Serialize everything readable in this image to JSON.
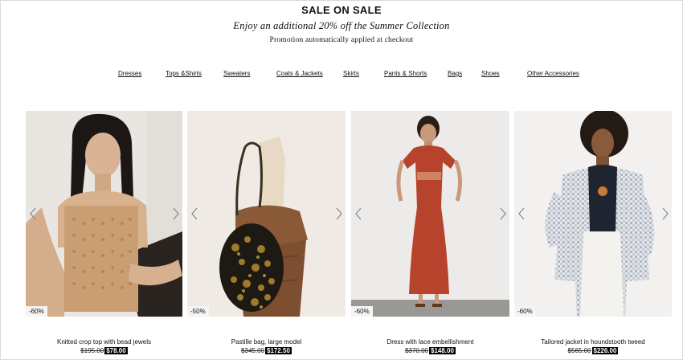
{
  "promo": {
    "title": "SALE ON SALE",
    "subtitle": "Enjoy an additional 20% off the Summer Collection",
    "note": "Promotion automatically applied at checkout"
  },
  "categories": [
    "Dresses",
    "Tops &Shirts",
    "Sweaters",
    "Coats & Jackets",
    "Skirts",
    "Pants & Shorts",
    "Bags",
    "Shoes",
    "Other Accessories"
  ],
  "products": [
    {
      "name": "Knitted crop top with bead jewels",
      "old_price": "$195.00",
      "new_price": "$78.00",
      "discount": "-60%"
    },
    {
      "name": "Pastille bag, large model",
      "old_price": "$345.00",
      "new_price": "$172.50",
      "discount": "-50%"
    },
    {
      "name": "Dress with lace embellishment",
      "old_price": "$370.00",
      "new_price": "$148.00",
      "discount": "-60%"
    },
    {
      "name": "Tailored jacket in houndstooth tweed",
      "old_price": "$565.00",
      "new_price": "$226.00",
      "discount": "-60%"
    }
  ],
  "icons": {
    "prev": "chevron-left-icon",
    "next": "chevron-right-icon"
  }
}
